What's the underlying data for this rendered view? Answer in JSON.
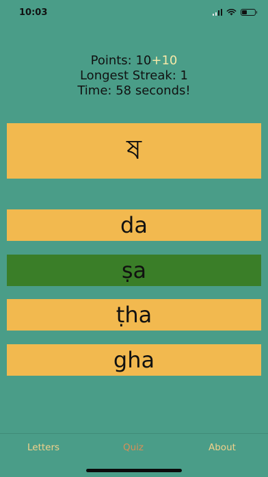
{
  "status_bar": {
    "time": "10:03",
    "icons": [
      "cellular-signal-icon",
      "wifi-icon",
      "battery-icon"
    ]
  },
  "stats": {
    "points_label": "Points: ",
    "points_value": "10",
    "points_bonus": "+10",
    "longest_streak": "Longest Streak: 1",
    "time": "Time: 58 seconds!"
  },
  "quiz": {
    "prompt_letter": "ষ",
    "answers": [
      {
        "label": "da",
        "state": "default"
      },
      {
        "label": "ṣa",
        "state": "correct"
      },
      {
        "label": "ṭha",
        "state": "default"
      },
      {
        "label": "gha",
        "state": "default"
      }
    ]
  },
  "tabs": [
    {
      "label": "Letters",
      "active": false
    },
    {
      "label": "Quiz",
      "active": true
    },
    {
      "label": "About",
      "active": false
    }
  ],
  "colors": {
    "background": "#4a9d88",
    "card": "#f2b94f",
    "correct": "#3a7e28",
    "tab_inactive": "#f4d28b",
    "tab_active": "#d98e57",
    "points_bonus": "#f7e9a8"
  }
}
